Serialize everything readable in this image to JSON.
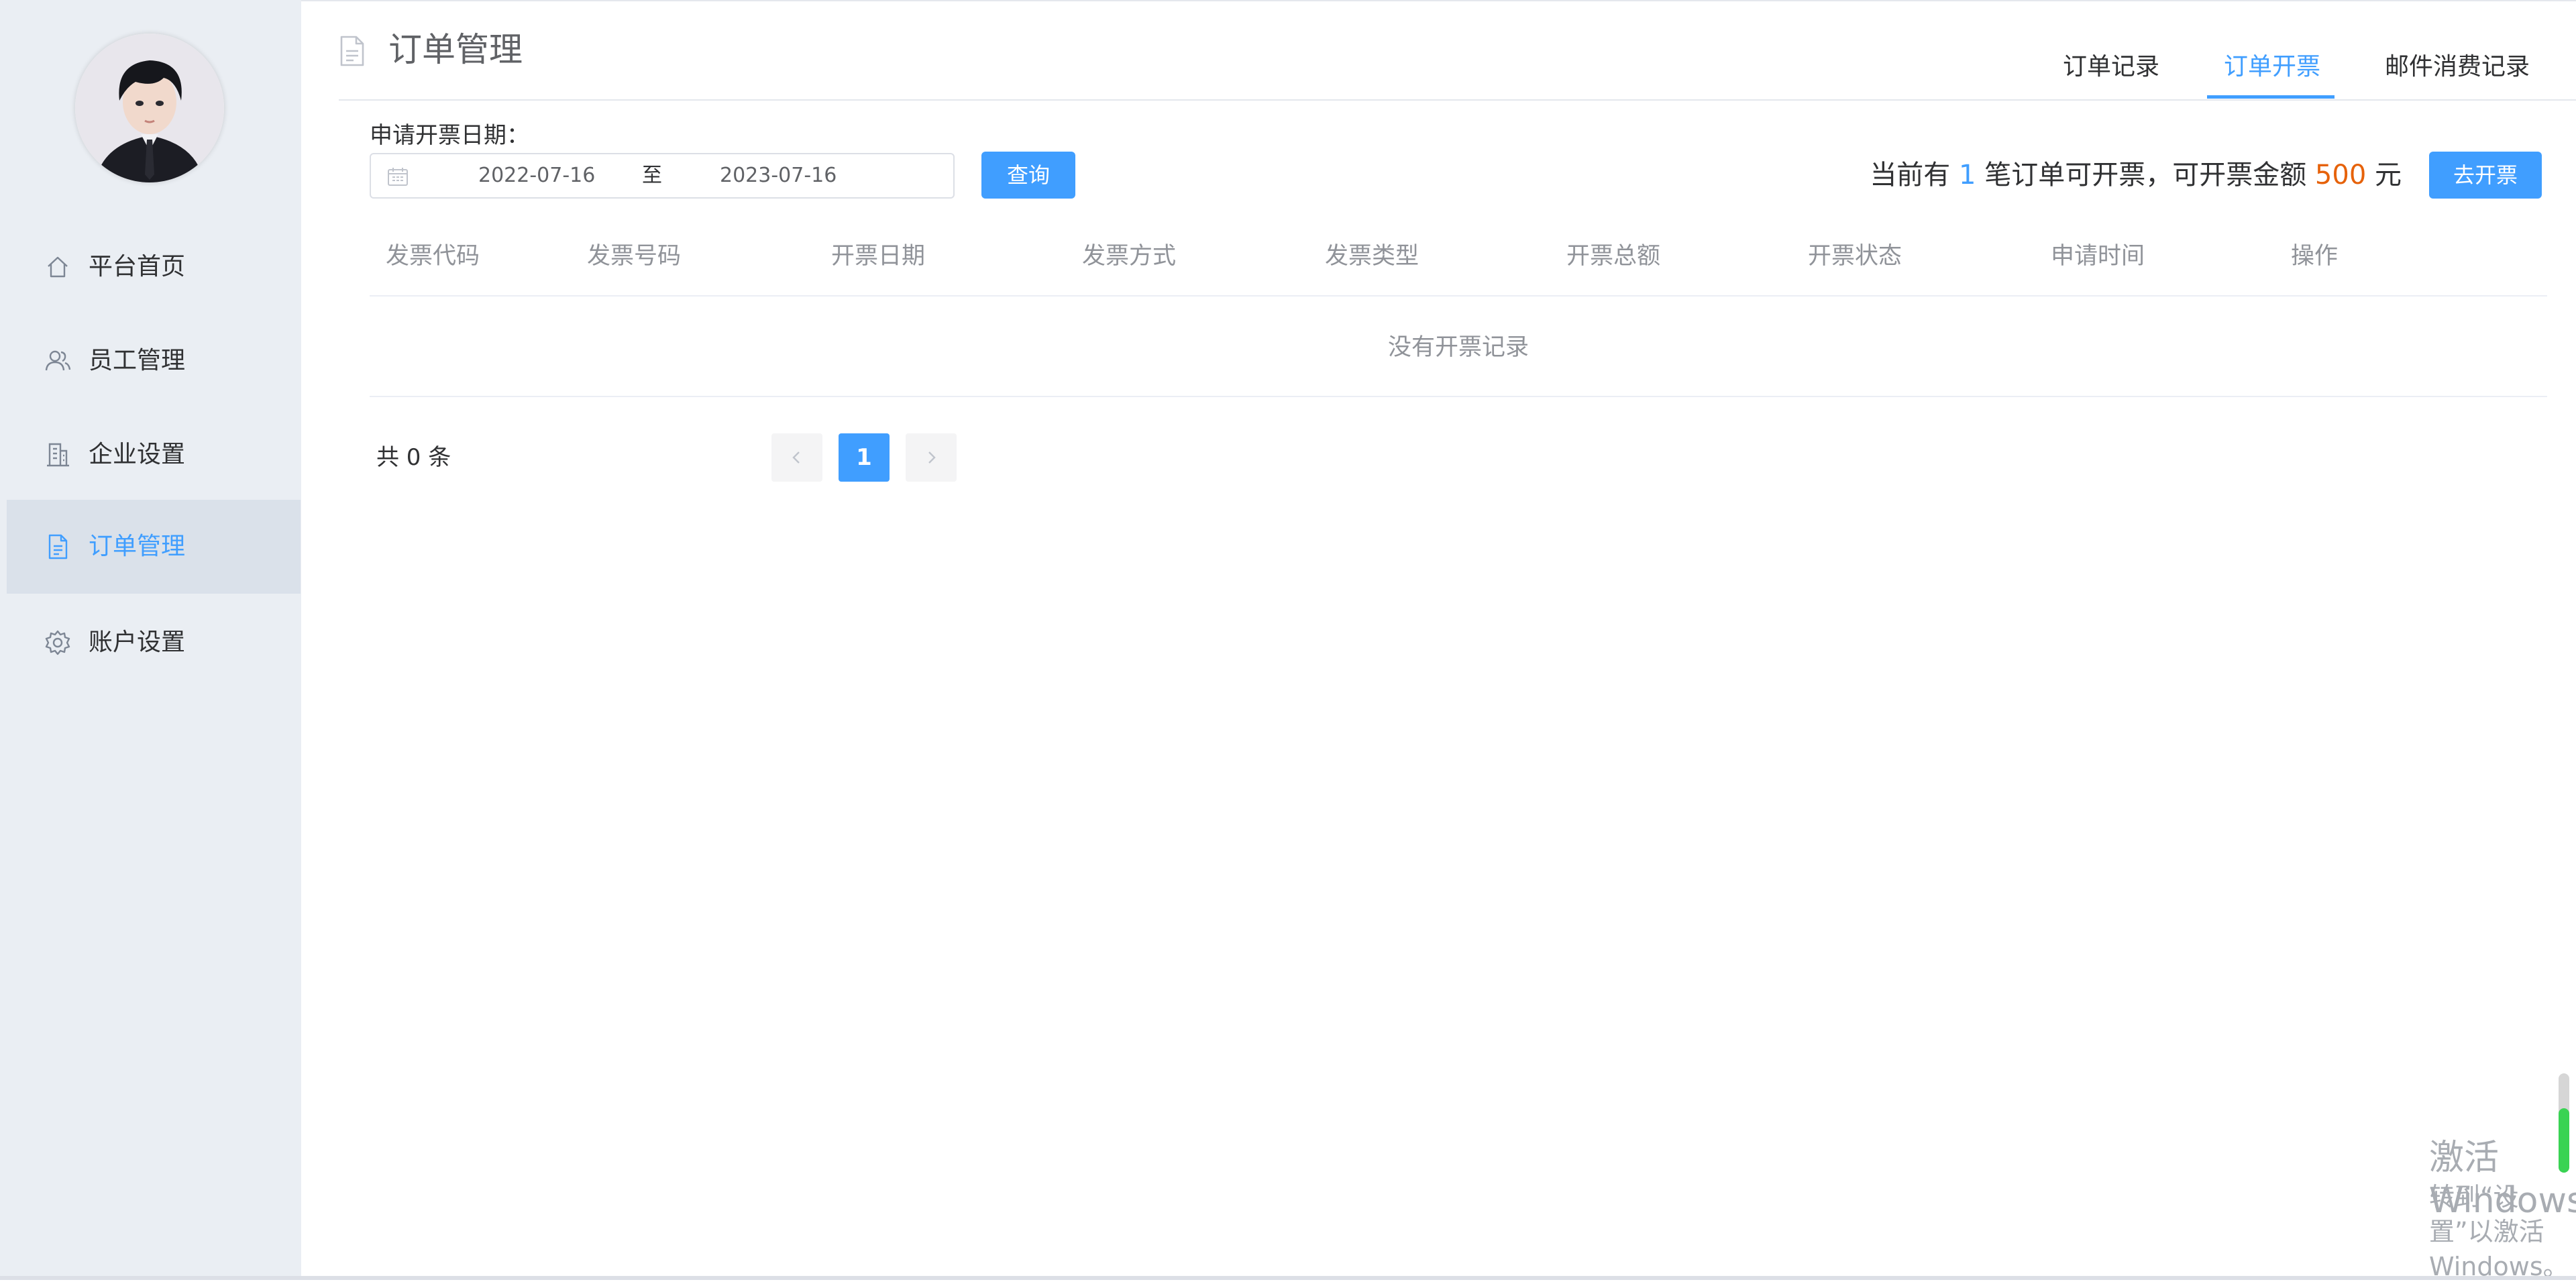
{
  "sidebar": {
    "items": [
      {
        "label": "平台首页",
        "icon": "home-icon"
      },
      {
        "label": "员工管理",
        "icon": "users-icon"
      },
      {
        "label": "企业设置",
        "icon": "building-icon"
      },
      {
        "label": "订单管理",
        "icon": "document-icon",
        "active": true
      },
      {
        "label": "账户设置",
        "icon": "gear-icon"
      }
    ]
  },
  "header": {
    "title": "订单管理",
    "tabs": [
      {
        "label": "订单记录"
      },
      {
        "label": "订单开票",
        "active": true
      },
      {
        "label": "邮件消费记录"
      }
    ]
  },
  "filter": {
    "label": "申请开票日期：",
    "start_date": "2022-07-16",
    "separator": "至",
    "end_date": "2023-07-16",
    "query_label": "查询"
  },
  "summary": {
    "prefix": "当前有",
    "count": "1",
    "middle": "笔订单可开票，可开票金额",
    "amount": "500",
    "suffix": "元",
    "button_label": "去开票"
  },
  "table": {
    "columns": [
      "发票代码",
      "发票号码",
      "开票日期",
      "发票方式",
      "发票类型",
      "开票总额",
      "开票状态",
      "申请时间",
      "操作"
    ],
    "rows": [],
    "empty_text": "没有开票记录"
  },
  "pagination": {
    "total_label": "共 0 条",
    "current_page": "1"
  },
  "watermark": {
    "title": "激活 Windows",
    "subtitle": "转到“设置”以激活 Windows。"
  },
  "colors": {
    "accent": "#409eff",
    "amount": "#e6620a",
    "sidebar_bg": "#eaeef3"
  }
}
